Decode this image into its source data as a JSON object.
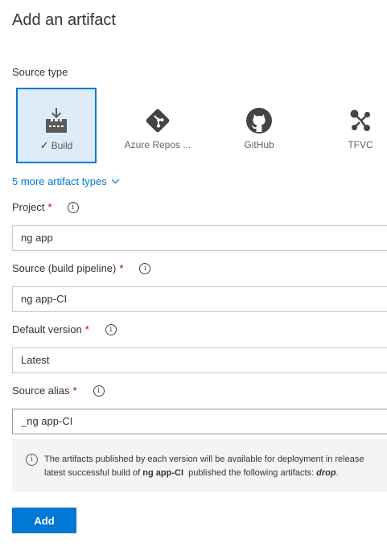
{
  "panel": {
    "title": "Add an artifact"
  },
  "source_type": {
    "label": "Source type",
    "tiles": [
      {
        "label": "Build",
        "icon": "build-icon",
        "selected": true
      },
      {
        "label": "Azure Repos ...",
        "icon": "azure-repos-icon",
        "selected": false
      },
      {
        "label": "GitHub",
        "icon": "github-icon",
        "selected": false
      },
      {
        "label": "TFVC",
        "icon": "tfvc-icon",
        "selected": false
      }
    ],
    "more_link": "5 more artifact types"
  },
  "fields": {
    "project": {
      "label": "Project",
      "required_mark": "*",
      "value": "ng app"
    },
    "source": {
      "label": "Source (build pipeline)",
      "required_mark": "*",
      "value": "ng app-CI"
    },
    "default_version": {
      "label": "Default version",
      "required_mark": "*",
      "value": "Latest"
    },
    "source_alias": {
      "label": "Source alias",
      "required_mark": "*",
      "value": "_ng app-CI"
    }
  },
  "message": {
    "line1": "The artifacts published by each version will be available for deployment in release",
    "line2_prefix": "latest successful build of ",
    "line2_pipeline": "ng app-CI",
    "line2_middle": "  published the following artifacts: ",
    "line2_artifact": "drop",
    "line2_suffix": "."
  },
  "actions": {
    "add_label": "Add"
  },
  "colors": {
    "accent": "#0078d4",
    "selected_bg": "#deecf9",
    "required": "#a80000"
  }
}
